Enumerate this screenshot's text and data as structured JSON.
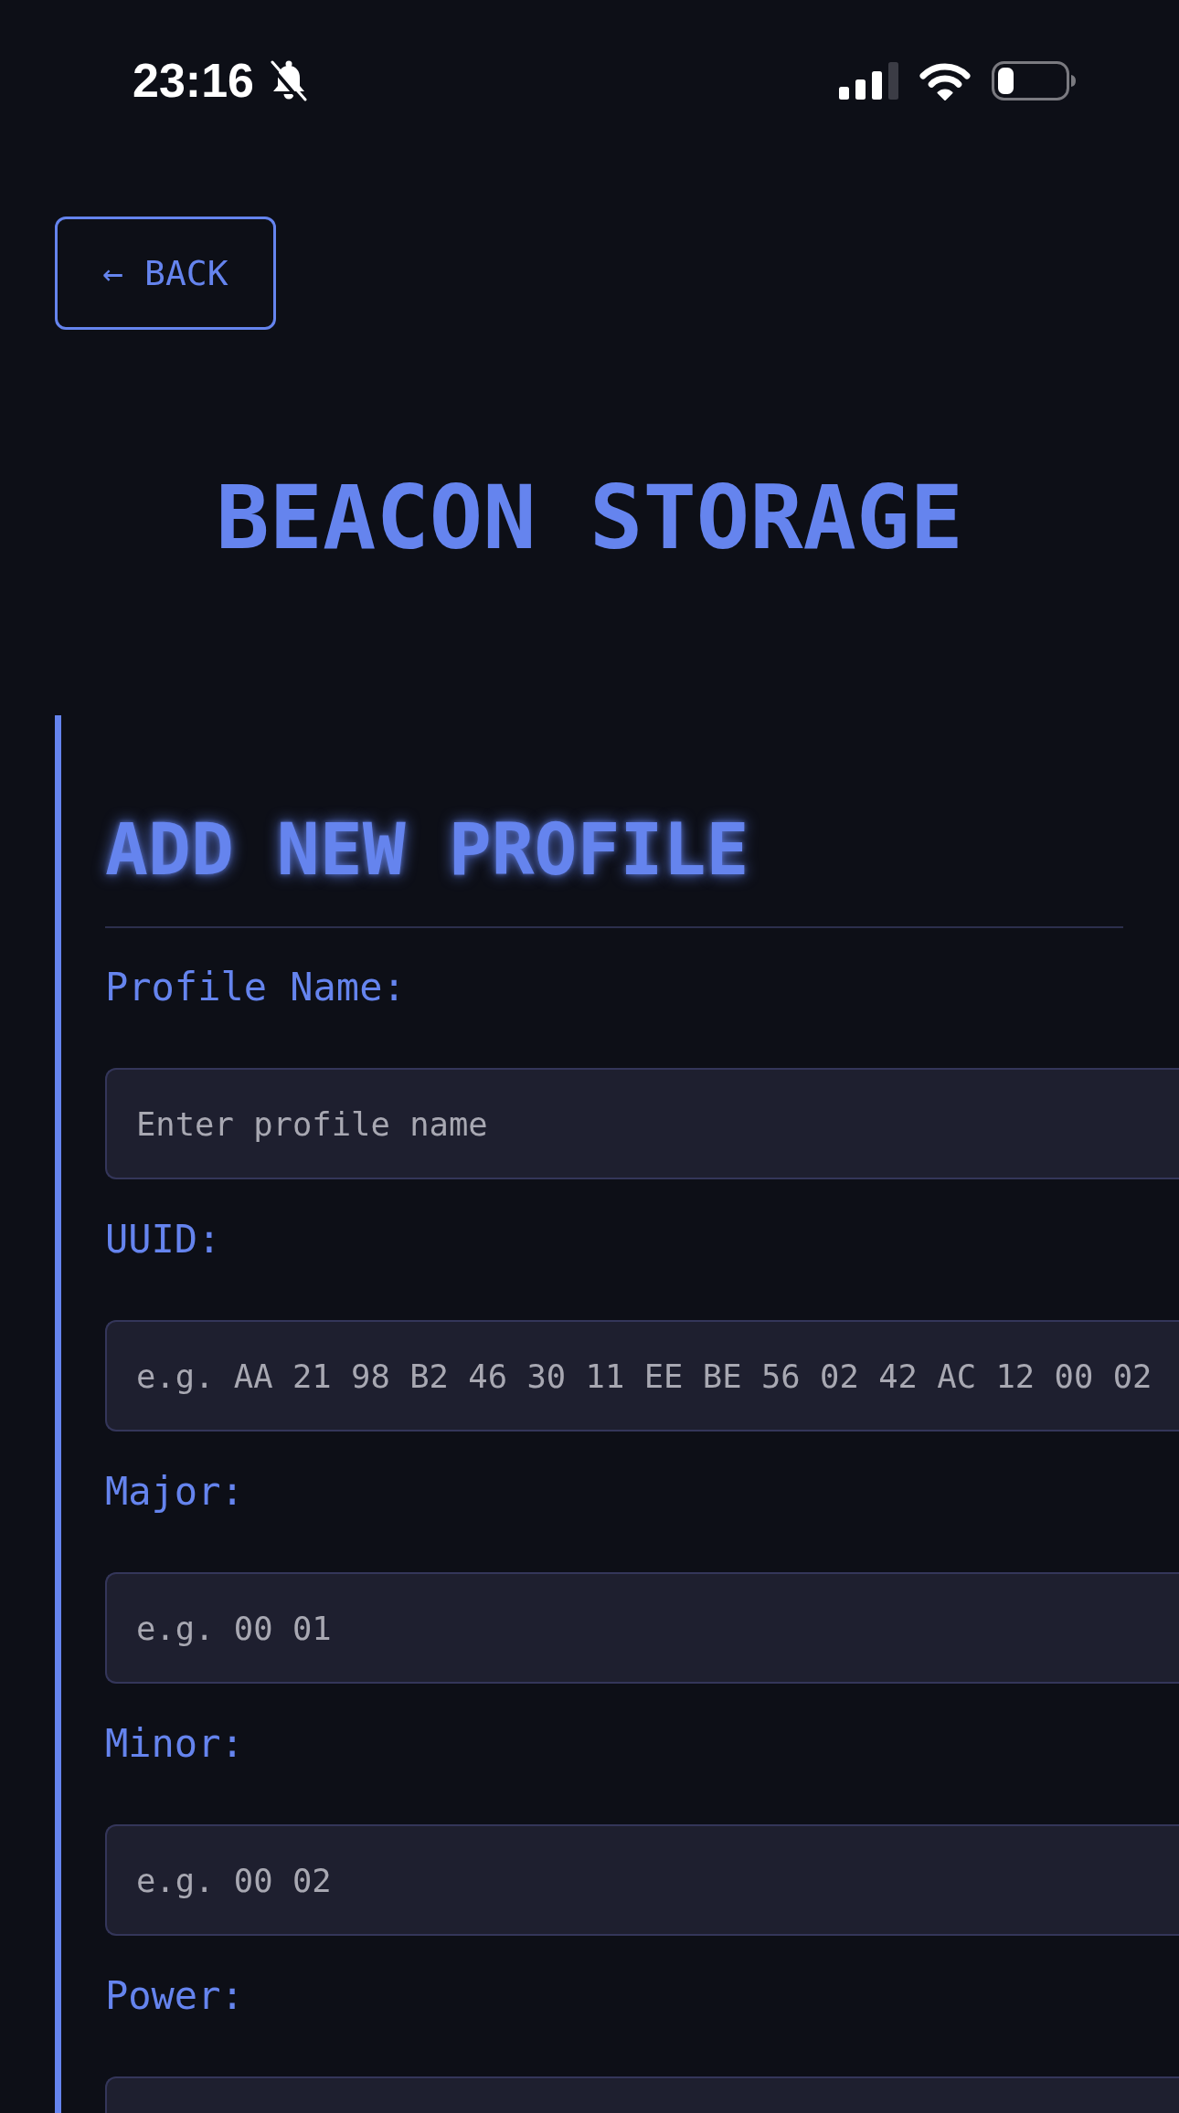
{
  "status_bar": {
    "time": "23:16"
  },
  "back_button": {
    "label": "← BACK"
  },
  "title": "BEACON STORAGE",
  "form": {
    "heading": "ADD NEW PROFILE",
    "fields": [
      {
        "label": "Profile Name:",
        "placeholder": "Enter profile name"
      },
      {
        "label": "UUID:",
        "placeholder": "e.g. AA 21 98 B2 46 30 11 EE BE 56 02 42 AC 12 00 02"
      },
      {
        "label": "Major:",
        "placeholder": "e.g. 00 01"
      },
      {
        "label": "Minor:",
        "placeholder": "e.g. 00 02"
      },
      {
        "label": "Power:"
      }
    ]
  }
}
